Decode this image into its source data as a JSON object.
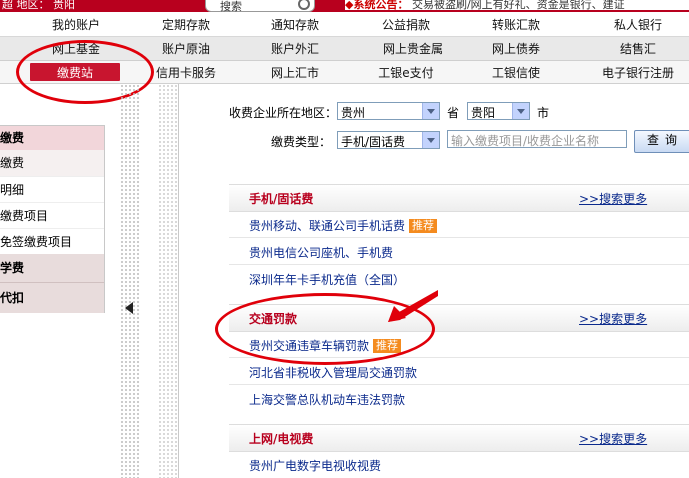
{
  "topbar": {
    "left_text": "超    地区：   贵阳",
    "search_label": "搜索",
    "notice_label": "◆系统公告：",
    "notice_text": "   交易被盗刷/网上有好礼、资金是银行、建证"
  },
  "nav": {
    "row1": [
      "我的账户",
      "定期存款",
      "通知存款",
      "公益捐款",
      "转账汇款",
      "私人银行"
    ],
    "row2": [
      "网上基金",
      "账户原油",
      "账户外汇",
      "网上贵金属",
      "网上债券",
      "结售汇"
    ],
    "row3": [
      "缴费站",
      "信用卡服务",
      "网上汇市",
      "工银e支付",
      "工银信使",
      "电子银行注册"
    ],
    "active": "缴费站"
  },
  "sidebar": {
    "items": [
      {
        "label": "缴费",
        "kind": "head"
      },
      {
        "label": "缴费",
        "kind": "sub"
      },
      {
        "label": "明细",
        "kind": "item"
      },
      {
        "label": "缴费项目",
        "kind": "item"
      },
      {
        "label": "免签缴费项目",
        "kind": "item"
      },
      {
        "label": "学费",
        "kind": "head"
      },
      {
        "label": "代扣",
        "kind": "head"
      }
    ]
  },
  "form": {
    "region_label": "收费企业所在地区：",
    "province_value": "贵州",
    "province_suffix": "省",
    "city_value": "贵阳",
    "city_suffix": "市",
    "type_label": "缴费类型：",
    "type_value": "手机/固话费",
    "keyword_placeholder": "输入缴费项目/收费企业名称",
    "query_label": "查询"
  },
  "sections": [
    {
      "title": "手机/固话费",
      "more": ">>搜索更多",
      "links": [
        {
          "text": "贵州移动、联通公司手机话费",
          "tag": "推荐"
        },
        {
          "text": "贵州电信公司座机、手机费",
          "tag": ""
        },
        {
          "text": "深圳年年卡手机充值（全国）",
          "tag": ""
        }
      ]
    },
    {
      "title": "交通罚款",
      "more": ">>搜索更多",
      "links": [
        {
          "text": "贵州交通违章车辆罚款",
          "tag": "推荐"
        },
        {
          "text": "河北省非税收入管理局交通罚款",
          "tag": ""
        },
        {
          "text": "上海交警总队机动车违法罚款",
          "tag": ""
        }
      ]
    },
    {
      "title": "上网/电视费",
      "more": ">>搜索更多",
      "links": [
        {
          "text": "贵州广电数字电视收视费",
          "tag": ""
        }
      ]
    }
  ],
  "colors": {
    "brand_red": "#c8152f",
    "link_blue": "#0b2a8c",
    "annotation_red": "#e0000a",
    "tag_orange": "#f48b1f"
  }
}
